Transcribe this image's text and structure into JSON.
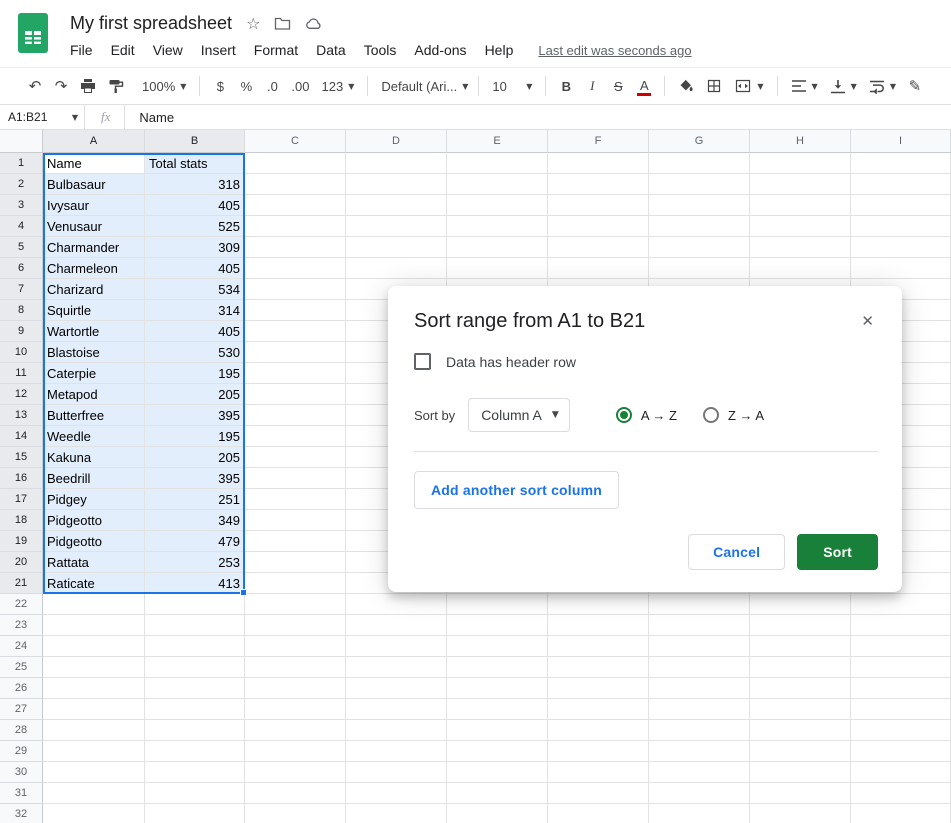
{
  "header": {
    "doc_title": "My first spreadsheet",
    "menus": [
      "File",
      "Edit",
      "View",
      "Insert",
      "Format",
      "Data",
      "Tools",
      "Add-ons",
      "Help"
    ],
    "last_edit": "Last edit was seconds ago"
  },
  "toolbar": {
    "zoom": "100%",
    "currency": "$",
    "percent": "%",
    "decrease_decimal": ".0",
    "increase_decimal": ".00",
    "more_formats": "123",
    "font_family": "Default (Ari...",
    "font_size": "10",
    "bold": "B",
    "italic": "I",
    "strikethrough": "S",
    "text_color": "A"
  },
  "formula_bar": {
    "name_box": "A1:B21",
    "fx_label": "fx",
    "content": "Name"
  },
  "grid": {
    "col_headers": [
      "A",
      "B",
      "C",
      "D",
      "E",
      "F",
      "G",
      "H",
      "I"
    ],
    "row_count": 32,
    "selection": {
      "rows": 21,
      "cols": 2,
      "active": "A1"
    },
    "cells": [
      [
        "Name",
        "Total stats"
      ],
      [
        "Bulbasaur",
        "318"
      ],
      [
        "Ivysaur",
        "405"
      ],
      [
        "Venusaur",
        "525"
      ],
      [
        "Charmander",
        "309"
      ],
      [
        "Charmeleon",
        "405"
      ],
      [
        "Charizard",
        "534"
      ],
      [
        "Squirtle",
        "314"
      ],
      [
        "Wartortle",
        "405"
      ],
      [
        "Blastoise",
        "530"
      ],
      [
        "Caterpie",
        "195"
      ],
      [
        "Metapod",
        "205"
      ],
      [
        "Butterfree",
        "395"
      ],
      [
        "Weedle",
        "195"
      ],
      [
        "Kakuna",
        "205"
      ],
      [
        "Beedrill",
        "395"
      ],
      [
        "Pidgey",
        "251"
      ],
      [
        "Pidgeotto",
        "349"
      ],
      [
        "Pidgeotto",
        "479"
      ],
      [
        "Rattata",
        "253"
      ],
      [
        "Raticate",
        "413"
      ]
    ]
  },
  "dialog": {
    "title": "Sort range from A1 to B21",
    "header_row_label": "Data has header row",
    "sort_by_label": "Sort by",
    "column_value": "Column A",
    "ascending_label": "A → Z",
    "descending_label": "Z → A",
    "add_sort_column_label": "Add another sort column",
    "cancel_label": "Cancel",
    "sort_label": "Sort"
  },
  "colors": {
    "accent_green": "#188038",
    "accent_blue": "#1a73e8",
    "text_color_bar": "#cc0000"
  }
}
